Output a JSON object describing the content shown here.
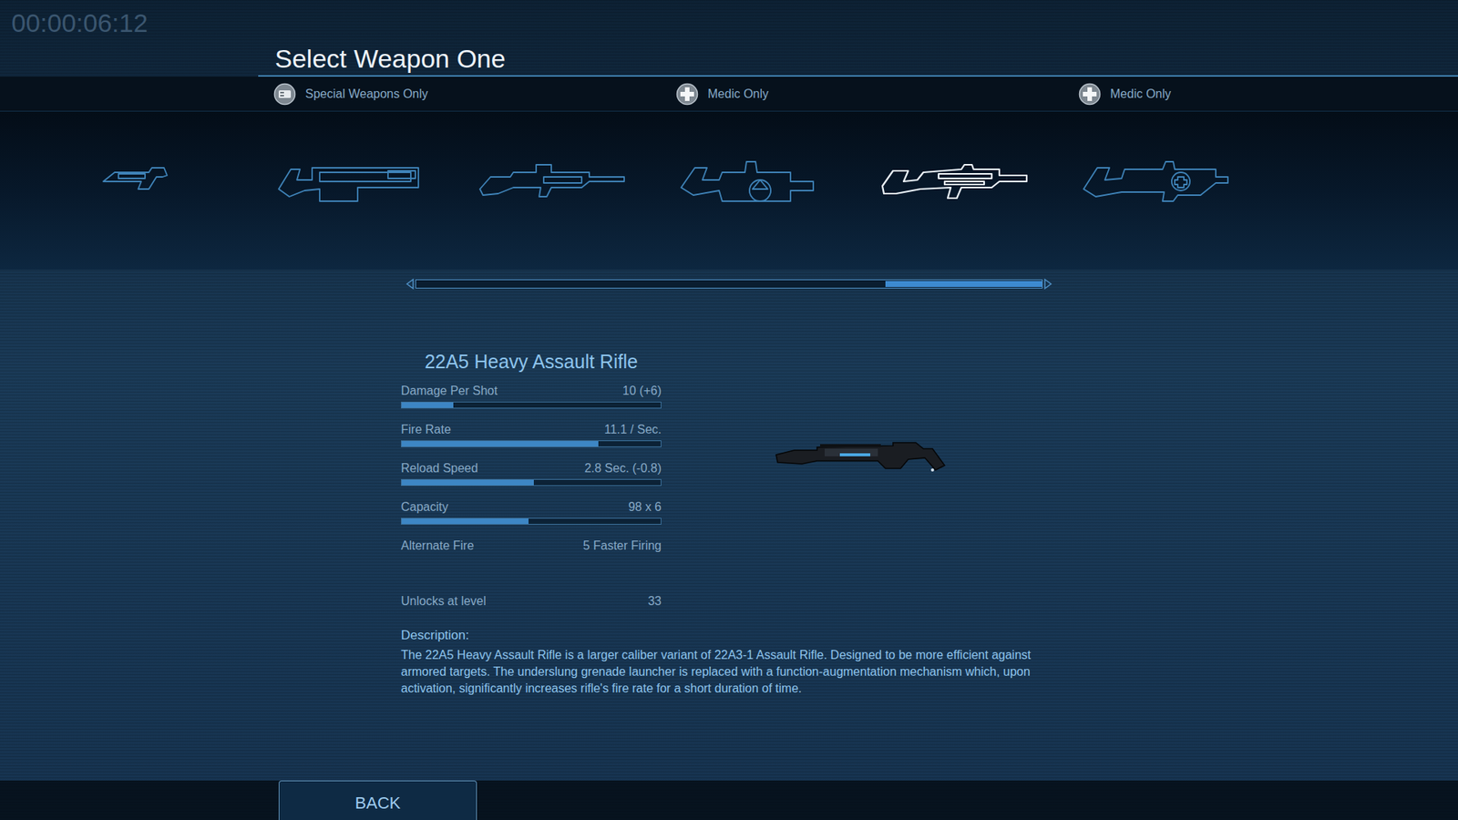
{
  "timer": "00:00:06:12",
  "title": "Select Weapon One",
  "weapons": [
    {
      "selected": false
    },
    {
      "selected": false,
      "restriction": {
        "text": "Special Weapons Only",
        "kind": "special"
      }
    },
    {
      "selected": false
    },
    {
      "selected": false,
      "restriction": {
        "text": "Medic Only",
        "kind": "medic"
      }
    },
    {
      "selected": true
    },
    {
      "selected": false,
      "restriction": {
        "text": "Medic Only",
        "kind": "medic"
      }
    }
  ],
  "scrollbar": {
    "level": 1
  },
  "weapon": {
    "name": "22A5 Heavy Assault Rifle",
    "stats": [
      {
        "label": "Damage Per Shot",
        "value": "10 (+6)",
        "level": 0.2
      },
      {
        "label": "Fire Rate",
        "value": "11.1 / Sec.",
        "level": 0.76
      },
      {
        "label": "Reload Speed",
        "value": "2.8 Sec. (-0.8)",
        "level": 0.51
      },
      {
        "label": "Capacity",
        "value": "98 x 6",
        "level": 0.49
      }
    ],
    "alt_fire": {
      "label": "Alternate Fire",
      "value": "5 Faster Firing"
    },
    "unlock": {
      "label": "Unlocks at level",
      "value": "33"
    },
    "description_label": "Description:",
    "description": "The 22A5 Heavy Assault Rifle is a larger caliber variant of 22A3-1 Assault Rifle. Designed to be more efficient against armored targets. The underslung grenade launcher is replaced with a function-augmentation mechanism which, upon activation, significantly increases rifle's fire rate for a short duration of time."
  },
  "buttons": [
    "BACK"
  ]
}
